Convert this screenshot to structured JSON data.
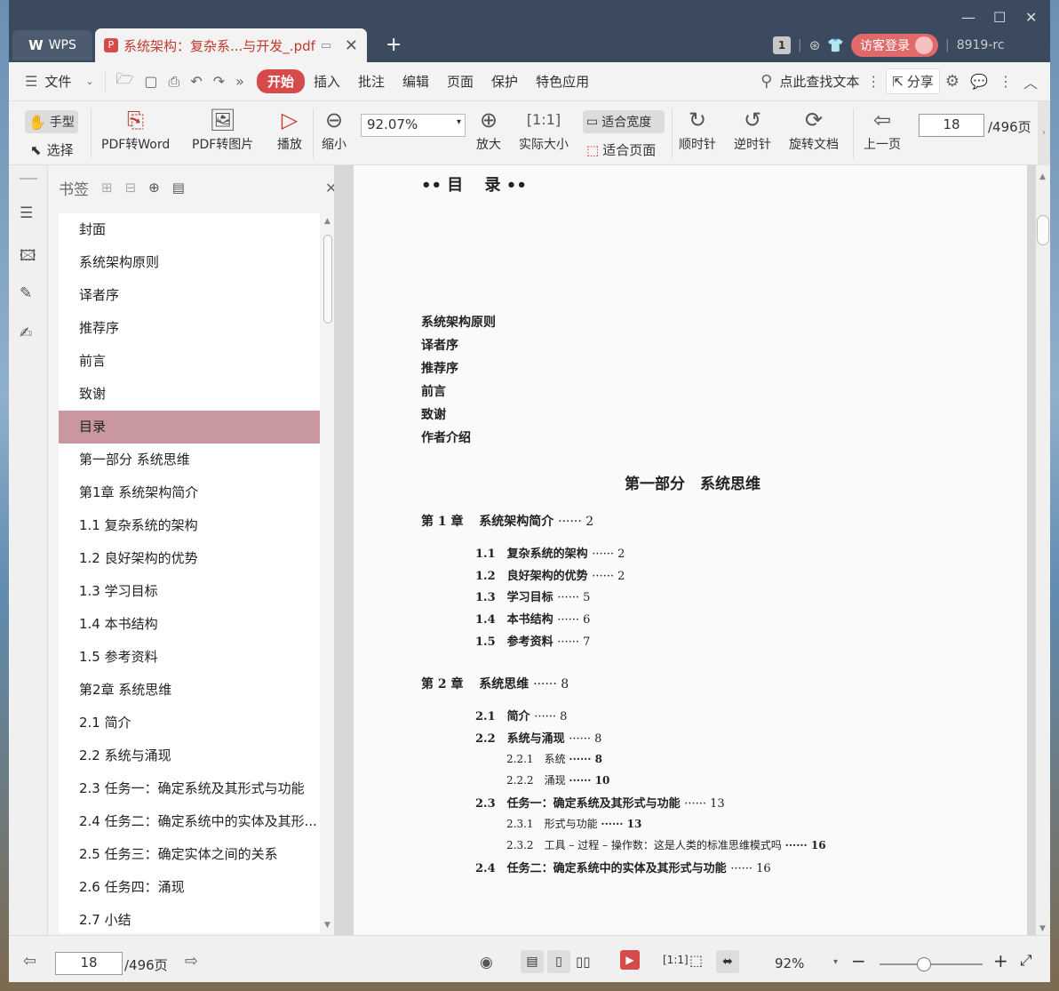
{
  "window": {
    "tab_wps": "WPS",
    "tab_doc": "系统架构：复杂系...与开发_.pdf",
    "page_count_badge": "1",
    "login": "访客登录",
    "user_id": "8919-rc"
  },
  "menu": {
    "file": "文件",
    "items": [
      "开始",
      "插入",
      "批注",
      "编辑",
      "页面",
      "保护",
      "特色应用"
    ],
    "search": "点此查找文本",
    "share": "分享"
  },
  "toolbar": {
    "hand": "手型",
    "select": "选择",
    "pdf2word": "PDF转Word",
    "pdf2img": "PDF转图片",
    "play": "播放",
    "zoom_out": "缩小",
    "zoom_value": "92.07%",
    "zoom_in": "放大",
    "actual_size": "实际大小",
    "fit_width": "适合宽度",
    "fit_page": "适合页面",
    "cw": "顺时针",
    "ccw": "逆时针",
    "rotate_doc": "旋转文档",
    "prev_page": "上一页",
    "page": "18",
    "total": "/496页"
  },
  "bookmarks": {
    "title": "书签",
    "items": [
      "封面",
      "系统架构原则",
      "译者序",
      "推荐序",
      "前言",
      "致谢",
      "目录",
      "第一部分 系统思维",
      "第1章 系统架构简介",
      "1.1 复杂系统的架构",
      "1.2 良好架构的优势",
      "1.3 学习目标",
      "1.4 本书结构",
      "1.5 参考资料",
      "第2章 系统思维",
      "2.1 简介",
      "2.2 系统与涌现",
      "2.3 任务一：确定系统及其形式与功能",
      "2.4 任务二：确定系统中的实体及其形...",
      "2.5 任务三：确定实体之间的关系",
      "2.6 任务四：涌现",
      "2.7 小结"
    ],
    "selected_index": 6
  },
  "doc": {
    "heading": "•• 目　 录 ••",
    "front": [
      "系统架构原则",
      "译者序",
      "推荐序",
      "前言",
      "致谢",
      "作者介绍"
    ],
    "part": "第一部分　系统思维",
    "ch1": {
      "num": "第 1 章",
      "title": "系统架构简介",
      "page": "······ 2"
    },
    "ch1_sections": [
      {
        "num": "1.1",
        "title": "复杂系统的架构",
        "page": "······ 2"
      },
      {
        "num": "1.2",
        "title": "良好架构的优势",
        "page": "······ 2"
      },
      {
        "num": "1.3",
        "title": "学习目标",
        "page": "······ 5"
      },
      {
        "num": "1.4",
        "title": "本书结构",
        "page": "······ 6"
      },
      {
        "num": "1.5",
        "title": "参考资料",
        "page": "······ 7"
      }
    ],
    "ch2": {
      "num": "第 2 章",
      "title": "系统思维",
      "page": "······ 8"
    },
    "s21": {
      "num": "2.1",
      "title": "简介",
      "page": "······ 8"
    },
    "s22": {
      "num": "2.2",
      "title": "系统与涌现",
      "page": "······ 8"
    },
    "s221": {
      "num": "2.2.1",
      "title": "系统",
      "page": "······ 8"
    },
    "s222": {
      "num": "2.2.2",
      "title": "涌现",
      "page": "······ 10"
    },
    "s23": {
      "num": "2.3",
      "title": "任务一：确定系统及其形式与功能",
      "page": "······ 13"
    },
    "s231": {
      "num": "2.3.1",
      "title": "形式与功能",
      "page": "······ 13"
    },
    "s232": {
      "num": "2.3.2",
      "title": "工具 – 过程 – 操作数：这是人类的标准思维模式吗",
      "page": "······ 16"
    },
    "s24": {
      "num": "2.4",
      "title": "任务二：确定系统中的实体及其形式与功能",
      "page": "······ 16"
    }
  },
  "status": {
    "page": "18",
    "total": "/496页",
    "zoom": "92%"
  }
}
